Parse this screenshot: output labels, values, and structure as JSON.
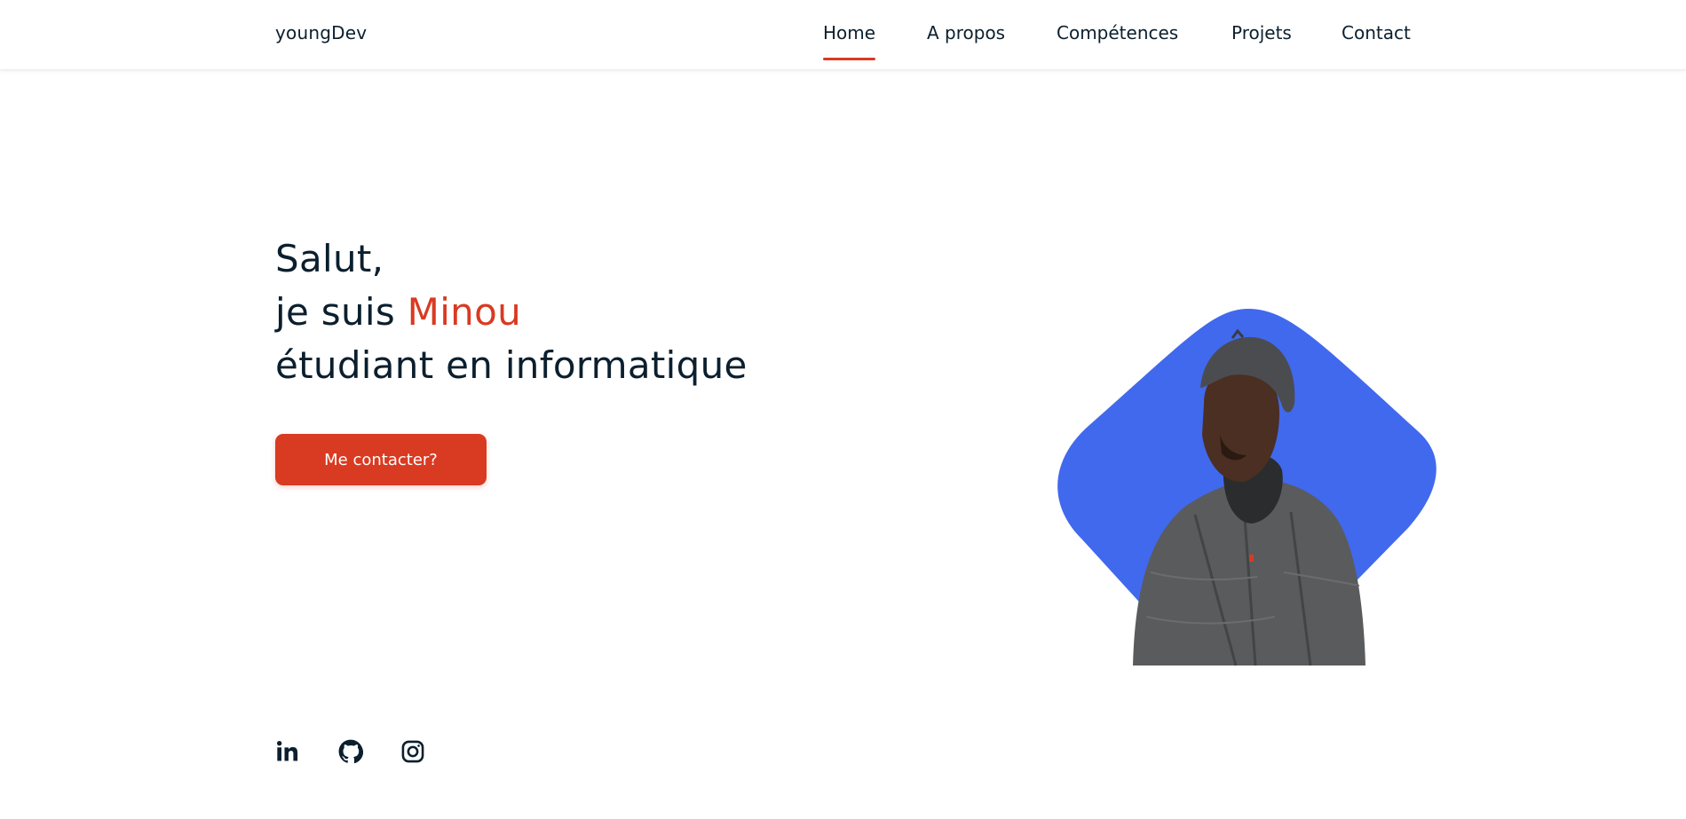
{
  "header": {
    "logo": "youngDev",
    "nav": [
      {
        "label": "Home",
        "active": true
      },
      {
        "label": "A propos",
        "active": false
      },
      {
        "label": "Compétences",
        "active": false
      },
      {
        "label": "Projets",
        "active": false
      },
      {
        "label": "Contact",
        "active": false
      }
    ]
  },
  "hero": {
    "line1": "Salut,",
    "line2_prefix": "je suis ",
    "name": "Minou",
    "line3": "étudiant en informatique",
    "button_label": "Me contacter?"
  },
  "socials": [
    {
      "icon": "linkedin-icon"
    },
    {
      "icon": "github-icon"
    },
    {
      "icon": "instagram-icon"
    }
  ],
  "colors": {
    "accent": "#d93a22",
    "blob": "#4169ee",
    "text": "#0b1f2e"
  }
}
